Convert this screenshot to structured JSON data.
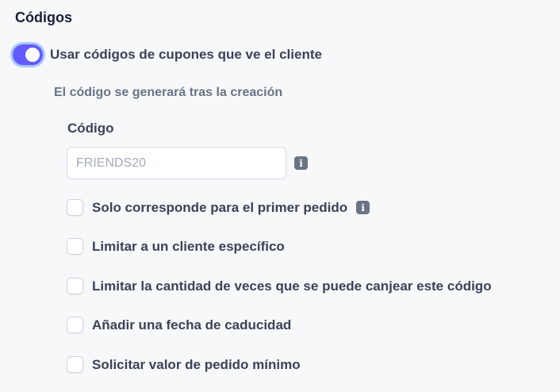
{
  "section": {
    "title": "Códigos"
  },
  "toggle": {
    "label": "Usar códigos de cupones que ve el cliente",
    "on": true
  },
  "note": "El código se generará tras la creación",
  "code_field": {
    "label": "Código",
    "placeholder": "FRIENDS20",
    "value": ""
  },
  "options": [
    {
      "label": "Solo corresponde para el primer pedido",
      "checked": false,
      "info_icon": "info-icon"
    },
    {
      "label": "Limitar a un cliente específico",
      "checked": false
    },
    {
      "label": "Limitar la cantidad de veces que se puede canjear este código",
      "checked": false
    },
    {
      "label": "Añadir una fecha de caducidad",
      "checked": false
    },
    {
      "label": "Solicitar valor de pedido mínimo",
      "checked": false
    }
  ],
  "colors": {
    "accent": "#635bff",
    "focus_ring": "#a9c8ff",
    "icon_bg": "#6b7385"
  }
}
